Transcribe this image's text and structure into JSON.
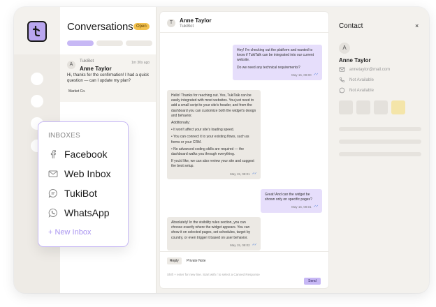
{
  "colors": {
    "accent": "#c7b8f5",
    "accent_text": "#a994f0",
    "badge": "#f2c14e",
    "outgoing_bubble": "#e6defb",
    "incoming_bubble": "#ece9e4",
    "tick": "#4f7fd9"
  },
  "sidebar": {
    "logo_icon": "tukitalk-logo-icon"
  },
  "conversations": {
    "title": "Conversations",
    "badge": "Open",
    "item": {
      "avatar": "A",
      "source": "TukiBot",
      "time": "1m 30s ago",
      "name": "Anne Taylor",
      "preview": "Hi, thanks for the confirmation! I had a quick question — can I update my plan?",
      "tag": "Market Co."
    }
  },
  "chat": {
    "avatar": "T",
    "name": "Anne Taylor",
    "source": "TukiBot",
    "messages": [
      {
        "dir": "out",
        "paragraphs": [
          "Hey! I'm checking out the platform and wanted to know if TukiTalk can be integrated into our current website.",
          "Do we need any technical requirements?"
        ],
        "time": "May 15, 08:00"
      },
      {
        "dir": "in",
        "paragraphs": [
          "Hello! Thanks for reaching out. Yes, TukiTalk can be easily integrated with most websites. You just need to add a small script to your site's header, and from the dashboard you can customize both the widget's design and behavior.",
          "Additionally:",
          "• It won't affect your site's loading speed.",
          "• You can connect it to your existing flows, such as forms or your CRM.",
          "• No advanced coding skills are required — the dashboard walks you through everything.",
          "If you'd like, we can also review your site and suggest the best setup."
        ],
        "time": "May 15, 08:01"
      },
      {
        "dir": "out",
        "paragraphs": [
          "Great! And can the widget be shown only on specific pages?"
        ],
        "time": "May 15, 08:01"
      },
      {
        "dir": "in",
        "paragraphs": [
          "Absolutely! In the visibility rules section, you can choose exactly where the widget appears. You can show it on selected pages, set schedules, target by country, or even trigger it based on user behavior."
        ],
        "time": "May 15, 08:02"
      }
    ],
    "composer": {
      "tab_reply": "Reply",
      "tab_note": "Private Note",
      "placeholder": "Shift + enter for new line. Start with / to select a Canned Response",
      "send": "Send"
    }
  },
  "contact": {
    "title": "Contact",
    "close": "×",
    "avatar": "A",
    "name": "Anne Taylor",
    "email": "annetaylor@mail.com",
    "phone": "Not Available",
    "whatsapp": "Not Available"
  },
  "inboxes": {
    "title": "INBOXES",
    "items": [
      {
        "label": "Facebook",
        "icon": "facebook-icon"
      },
      {
        "label": "Web Inbox",
        "icon": "mail-icon"
      },
      {
        "label": "TukiBot",
        "icon": "chat-bubble-icon"
      },
      {
        "label": "WhatsApp",
        "icon": "whatsapp-icon"
      }
    ],
    "new_inbox": "+ New Inbox"
  }
}
